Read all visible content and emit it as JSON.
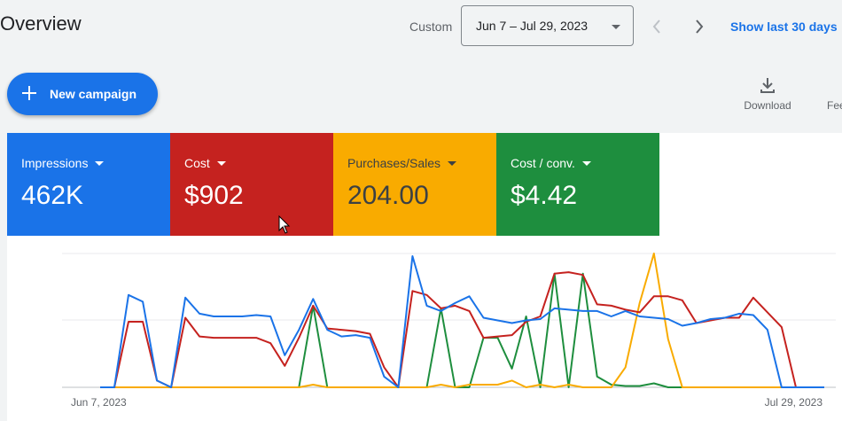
{
  "header": {
    "title": "Overview",
    "custom_label": "Custom",
    "date_range": "Jun 7 – Jul 29, 2023",
    "show_last": "Show last 30 days"
  },
  "actions": {
    "new_campaign": "New campaign",
    "download": "Download",
    "feedback": "Fee"
  },
  "metrics": [
    {
      "name": "Impressions",
      "value": "462K",
      "color": "#1a73e8"
    },
    {
      "name": "Cost",
      "value": "$902",
      "color": "#c5221f"
    },
    {
      "name": "Purchases/Sales",
      "value": "204.00",
      "color": "#f9ab00"
    },
    {
      "name": "Cost / conv.",
      "value": "$4.42",
      "color": "#1e8e3e"
    }
  ],
  "chart_data": {
    "type": "line",
    "x_start_label": "Jun 7, 2023",
    "x_end_label": "Jul 29, 2023",
    "grid": true,
    "y_unit": "fraction of each metric's own maximum",
    "series": [
      {
        "name": "Impressions",
        "color": "#1a73e8",
        "values": [
          0,
          0,
          0.69,
          0.64,
          0.05,
          0,
          0.67,
          0.55,
          0.53,
          0.53,
          0.53,
          0.54,
          0.53,
          0.24,
          0.43,
          0.66,
          0.43,
          0.38,
          0.39,
          0.37,
          0.08,
          0,
          0.98,
          0.61,
          0.57,
          0.63,
          0.68,
          0.52,
          0.5,
          0.48,
          0.5,
          0.51,
          0.59,
          0.58,
          0.57,
          0.57,
          0.53,
          0.57,
          0.53,
          0.52,
          0.51,
          0.46,
          0.48,
          0.51,
          0.52,
          0.55,
          0.54,
          0.43,
          0,
          0,
          0,
          0
        ]
      },
      {
        "name": "Cost",
        "color": "#c5221f",
        "values": [
          0,
          0,
          0.49,
          0.49,
          0.05,
          0,
          0.52,
          0.38,
          0.37,
          0.37,
          0.37,
          0.37,
          0.33,
          0.16,
          0.37,
          0.61,
          0.44,
          0.43,
          0.42,
          0.4,
          0.15,
          0,
          0.72,
          0.69,
          0.59,
          0.61,
          0.57,
          0.37,
          0.38,
          0.39,
          0.49,
          0.53,
          0.85,
          0.86,
          0.84,
          0.62,
          0.61,
          0.58,
          0.56,
          0.68,
          0.68,
          0.65,
          0.48,
          0.5,
          0.52,
          0.52,
          0.67,
          0.56,
          0.45,
          0,
          0,
          0
        ]
      },
      {
        "name": "Purchases/Sales",
        "color": "#f9ab00",
        "values": [
          0,
          0,
          0,
          0,
          0,
          0,
          0,
          0,
          0,
          0,
          0,
          0,
          0,
          0,
          0,
          0.02,
          0,
          0,
          0,
          0,
          0,
          0,
          0,
          0,
          0.02,
          0,
          0.02,
          0.02,
          0.02,
          0.05,
          0,
          0.02,
          0,
          0.02,
          0,
          0,
          0,
          0.15,
          0.63,
          1.0,
          0.36,
          0,
          0,
          0,
          0,
          0,
          0,
          0,
          0,
          0,
          0,
          0
        ]
      },
      {
        "name": "Cost / conv.",
        "color": "#1e8e3e",
        "values": [
          0,
          0,
          0,
          0,
          0,
          0,
          0,
          0,
          0,
          0,
          0,
          0,
          0,
          0,
          0,
          0.61,
          0,
          0,
          0,
          0,
          0,
          0,
          0,
          0,
          0.59,
          0,
          0,
          0.37,
          0.37,
          0.14,
          0.53,
          0,
          0.85,
          0,
          0.85,
          0.08,
          0.02,
          0.01,
          0.01,
          0.03,
          0,
          0,
          0,
          0,
          0,
          0,
          0,
          0,
          0,
          0,
          0,
          0
        ]
      }
    ]
  }
}
